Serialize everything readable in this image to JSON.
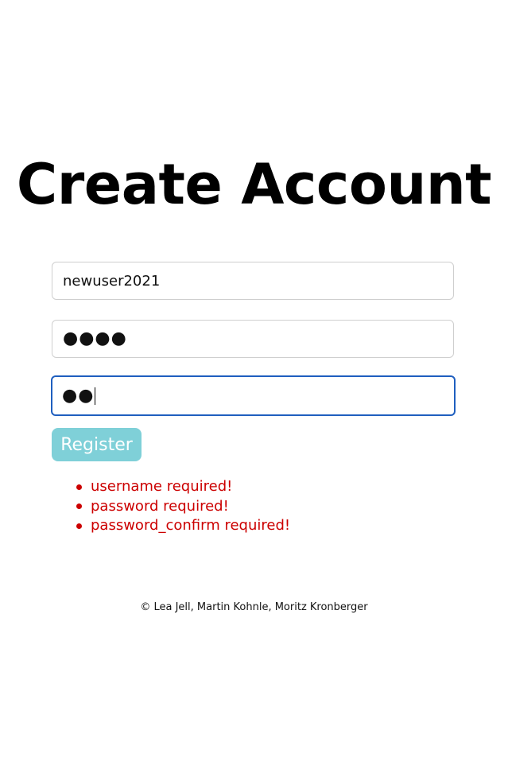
{
  "page": {
    "title": "Create Account"
  },
  "form": {
    "username_value": "newuser2021",
    "password_mask": "●●●●",
    "password_confirm_mask": "●●",
    "register_label": "Register"
  },
  "errors": [
    "username required!",
    "password required!",
    "password_confirm required!"
  ],
  "footer": {
    "text": "© Lea Jell, Martin Kohnle, Moritz Kronberger"
  },
  "colors": {
    "button_bg": "#7fd0d8",
    "error_text": "#cc0000",
    "focus_border": "#1f5fbf"
  }
}
